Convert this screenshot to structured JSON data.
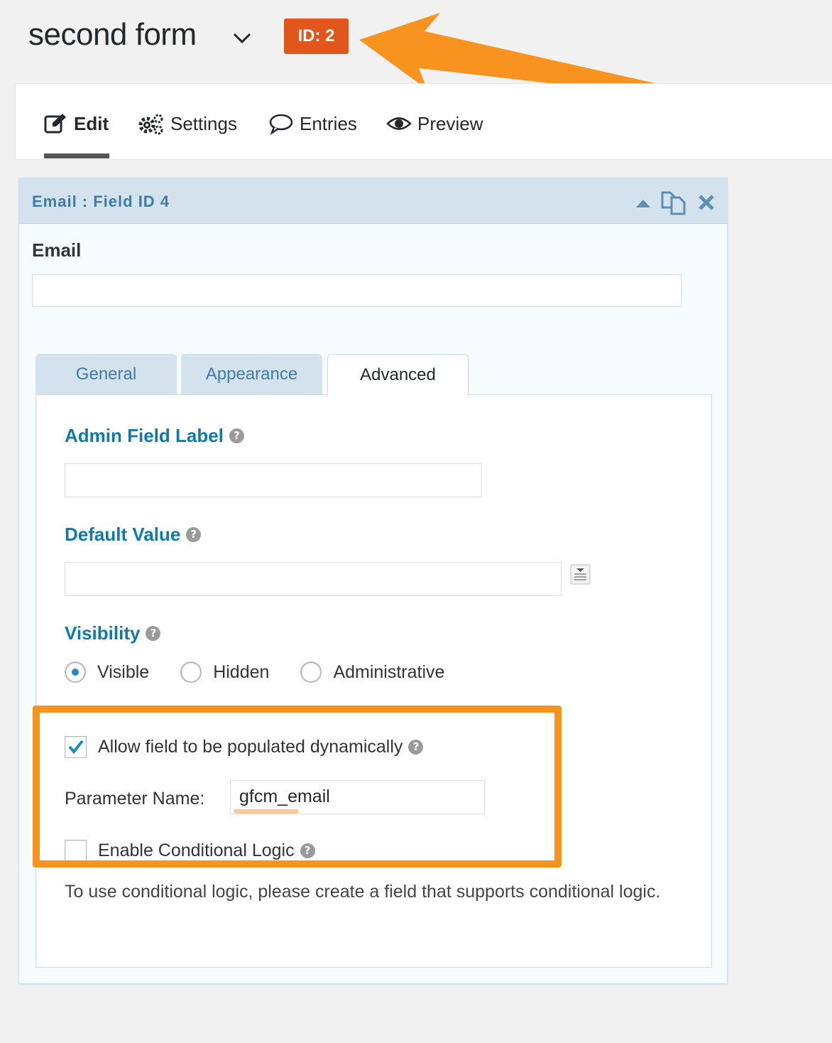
{
  "form": {
    "title": "second form",
    "id_badge": "ID: 2"
  },
  "colors": {
    "badge": "#e0561b",
    "arrow": "#f7931e",
    "highlight": "#f7931e",
    "label_blue": "#0e7aa9",
    "header_blue": "#3e7ca6"
  },
  "nav": {
    "edit": "Edit",
    "settings": "Settings",
    "entries": "Entries",
    "preview": "Preview"
  },
  "field": {
    "header": "Email : Field ID 4",
    "label": "Email",
    "tabs": {
      "general": "General",
      "appearance": "Appearance",
      "advanced": "Advanced"
    },
    "admin_label": {
      "title": "Admin Field Label",
      "help": "?"
    },
    "default_value": {
      "title": "Default Value",
      "help": "?"
    },
    "visibility": {
      "title": "Visibility",
      "help": "?",
      "options": [
        "Visible",
        "Hidden",
        "Administrative"
      ],
      "selected": "Visible"
    },
    "dynamic": {
      "label": "Allow field to be populated dynamically",
      "checked": true,
      "help": "?",
      "param_label": "Parameter Name:",
      "param_value": "gfcm_email"
    },
    "conditional": {
      "label": "Enable Conditional Logic",
      "checked": false,
      "help": "?",
      "note": "To use conditional logic, please create a field that supports conditional logic."
    }
  }
}
